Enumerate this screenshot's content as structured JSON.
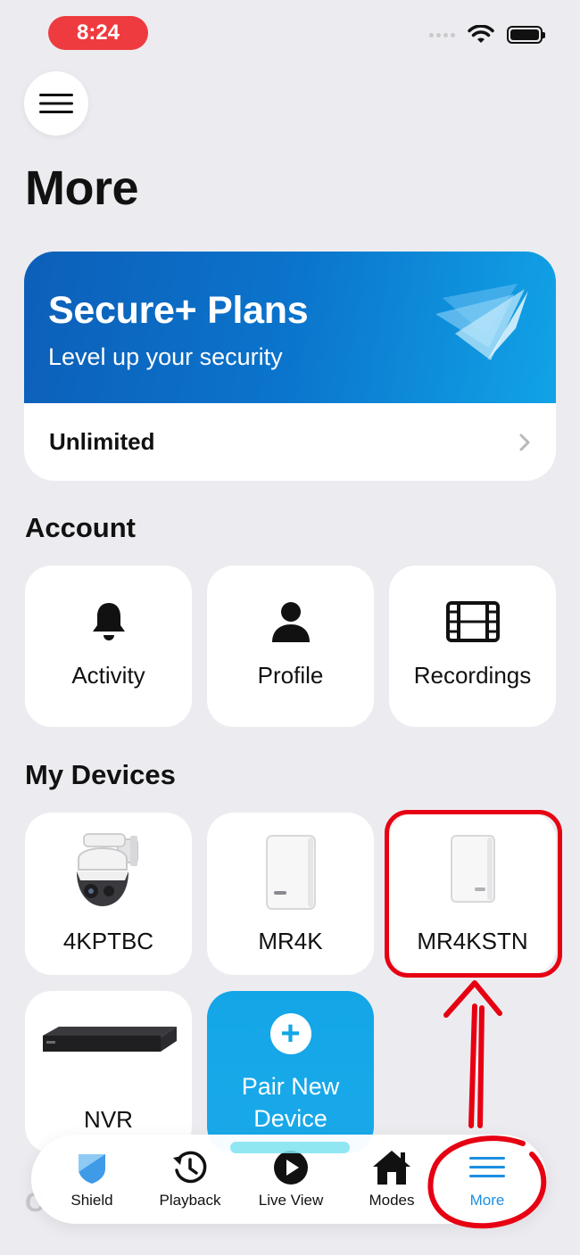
{
  "status_bar": {
    "time": "8:24"
  },
  "page": {
    "title": "More"
  },
  "plans": {
    "title": "Secure+ Plans",
    "subtitle": "Level up your security",
    "row_label": "Unlimited"
  },
  "account": {
    "title": "Account",
    "items": [
      {
        "label": "Activity",
        "icon": "bell-icon"
      },
      {
        "label": "Profile",
        "icon": "person-icon"
      },
      {
        "label": "Recordings",
        "icon": "film-icon"
      }
    ]
  },
  "devices": {
    "title": "My Devices",
    "items": [
      {
        "label": "4KPTBC"
      },
      {
        "label": "MR4K"
      },
      {
        "label": "MR4KSTN"
      },
      {
        "label": "NVR"
      }
    ],
    "pair_label": "Pair New Device"
  },
  "partial_section_text": "C",
  "tab_bar": {
    "items": [
      {
        "label": "Shield",
        "icon": "shield-icon"
      },
      {
        "label": "Playback",
        "icon": "history-icon"
      },
      {
        "label": "Live View",
        "icon": "play-icon"
      },
      {
        "label": "Modes",
        "icon": "home-icon"
      },
      {
        "label": "More",
        "icon": "menu-lines-icon",
        "active": true
      }
    ]
  },
  "colors": {
    "accent": "#1c8fe0",
    "annotation": "#e60012",
    "banner_start": "#0d5fb8",
    "banner_end": "#11a3e6"
  }
}
